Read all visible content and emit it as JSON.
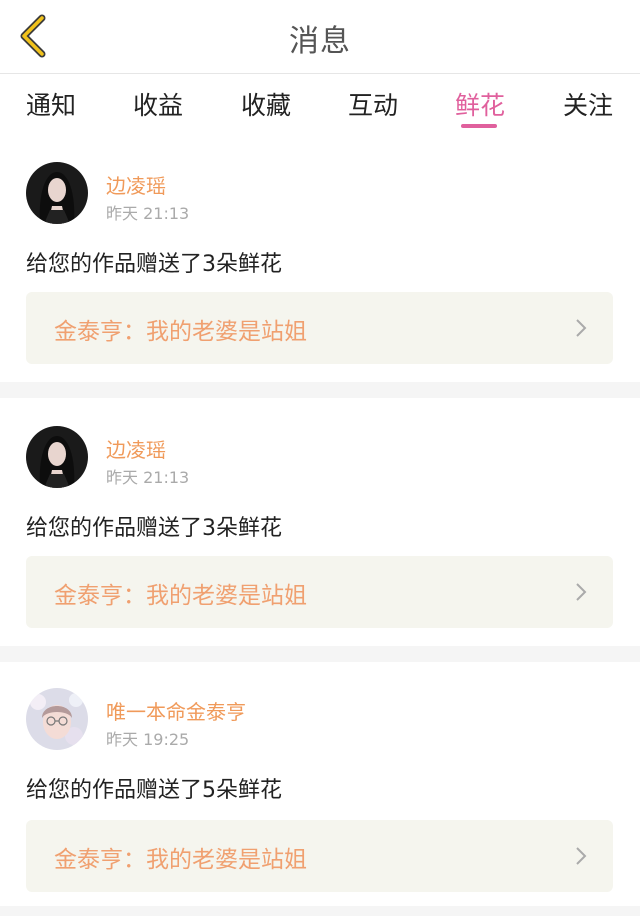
{
  "header": {
    "title": "消息",
    "back_icon": "chevron-left-icon"
  },
  "tabs": [
    {
      "label": "通知"
    },
    {
      "label": "收益"
    },
    {
      "label": "收藏"
    },
    {
      "label": "互动"
    },
    {
      "label": "鲜花",
      "active": true
    },
    {
      "label": "关注"
    }
  ],
  "colors": {
    "accent": "#e0609d",
    "username": "#f09a5a",
    "work_link": "#f0a070",
    "work_bg": "#f5f5ee"
  },
  "items": [
    {
      "username": "边凌瑶",
      "time": "昨天 21:13",
      "message": "给您的作品赠送了3朵鲜花",
      "work": "金泰亨：我的老婆是站姐"
    },
    {
      "username": "边凌瑶",
      "time": "昨天 21:13",
      "message": "给您的作品赠送了3朵鲜花",
      "work": "金泰亨：我的老婆是站姐"
    },
    {
      "username": "唯一本命金泰亨",
      "time": "昨天 19:25",
      "message": "给您的作品赠送了5朵鲜花",
      "work": "金泰亨：我的老婆是站姐"
    }
  ]
}
